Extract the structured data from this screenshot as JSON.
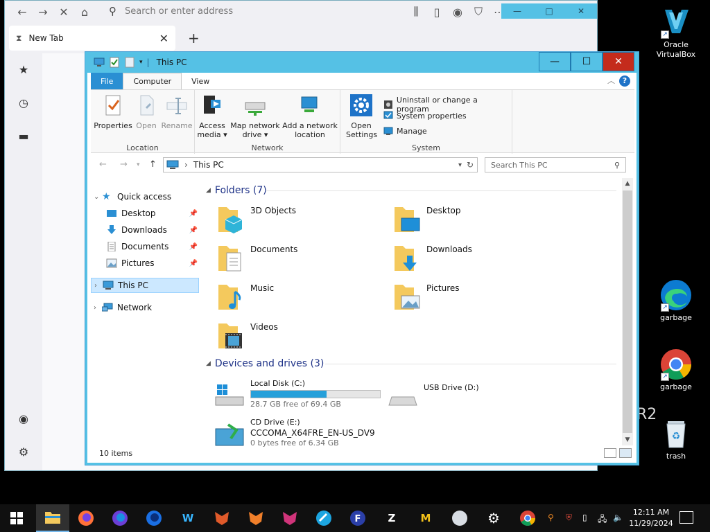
{
  "desktop": {
    "icons": [
      {
        "label": "Oracle VirtualBox",
        "icon": "virtualbox-icon"
      },
      {
        "label": "garbage",
        "icon": "edge-icon"
      },
      {
        "label": "garbage",
        "icon": "chrome-icon"
      },
      {
        "label": "trash",
        "icon": "recycle-bin-icon"
      }
    ],
    "wallpaper_text": "R2"
  },
  "browser": {
    "address_placeholder": "Search or enter address",
    "tab_title": "New Tab",
    "new_tab_symbol": "+"
  },
  "explorer": {
    "title": "This PC",
    "ribbon_tabs": [
      "File",
      "Computer",
      "View"
    ],
    "active_tab": "Computer",
    "ribbon": {
      "location": {
        "name": "Location",
        "buttons": [
          "Properties",
          "Open",
          "Rename"
        ]
      },
      "network": {
        "name": "Network",
        "buttons": [
          {
            "line1": "Access",
            "line2": "media ▾"
          },
          {
            "line1": "Map network",
            "line2": "drive ▾"
          },
          {
            "line1": "Add a network",
            "line2": "location"
          }
        ]
      },
      "system": {
        "name": "System",
        "open_settings": {
          "line1": "Open",
          "line2": "Settings"
        },
        "small": [
          "Uninstall or change a program",
          "System properties",
          "Manage"
        ]
      }
    },
    "address": "This PC",
    "search_placeholder": "Search This PC",
    "nav": {
      "quick_access": "Quick access",
      "pinned": [
        "Desktop",
        "Downloads",
        "Documents",
        "Pictures"
      ],
      "this_pc": "This PC",
      "network": "Network"
    },
    "folders_header": "Folders (7)",
    "folders": [
      "3D Objects",
      "Desktop",
      "Documents",
      "Downloads",
      "Music",
      "Pictures",
      "Videos"
    ],
    "devices_header": "Devices and drives (3)",
    "drives": {
      "c": {
        "name": "Local Disk (C:)",
        "free": "28.7 GB free of 69.4 GB",
        "used_fraction": 0.586
      },
      "d": {
        "name": "USB Drive (D:)"
      },
      "e": {
        "name": "CD Drive (E:)",
        "label": "CCCOMA_X64FRE_EN-US_DV9",
        "free": "0 bytes free of 6.34 GB"
      }
    },
    "status": "10 items"
  },
  "taskbar": {
    "time": "12:11 AM",
    "date": "11/29/2024"
  },
  "colors": {
    "titlebar": "#55c1e5",
    "accent": "#2a8fd3",
    "close": "#c42b1c",
    "drive_bar": "#26a0da",
    "group_header": "#1e3287"
  }
}
